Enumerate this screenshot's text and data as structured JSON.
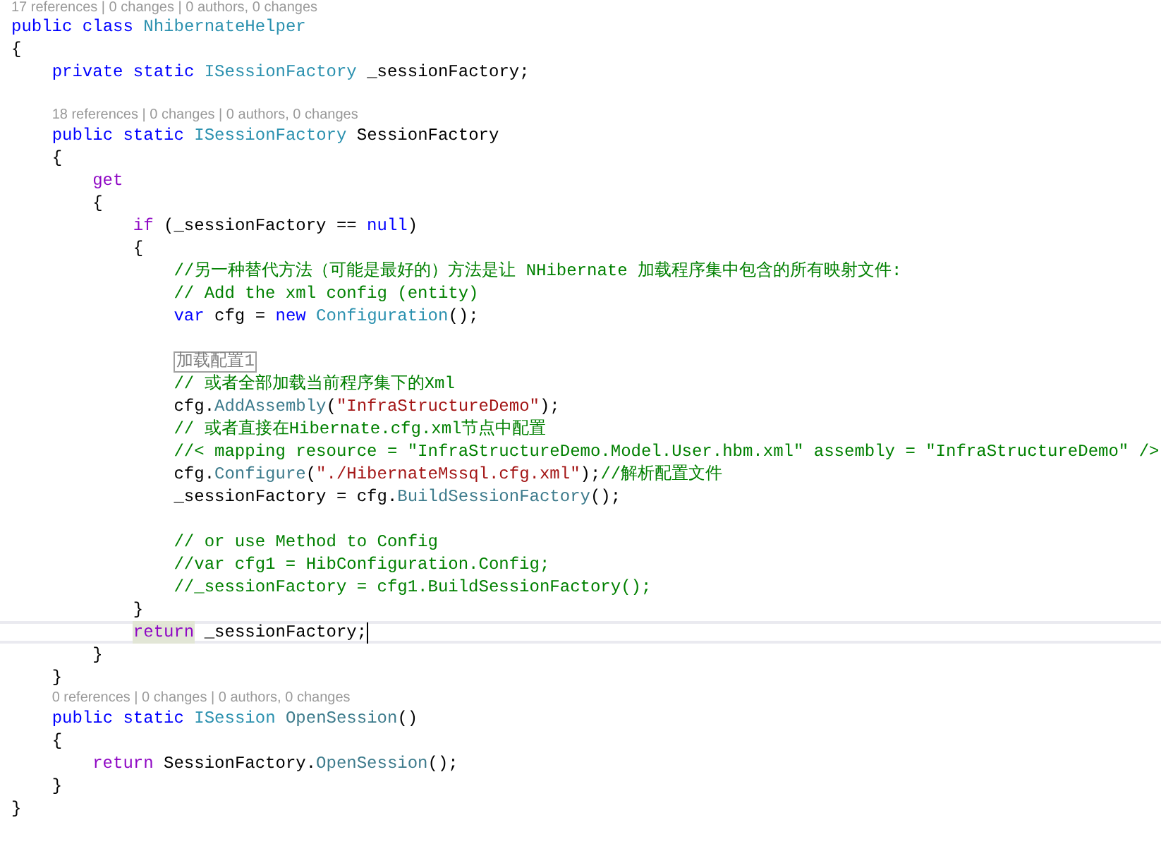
{
  "editor": {
    "lines": [
      {
        "kind": "lens",
        "text": "17 references | 0 changes | 0 authors, 0 changes"
      },
      {
        "kind": "code",
        "tokens": [
          {
            "kind": "kw",
            "text": "public"
          },
          {
            "kind": "kw",
            "text": " class"
          },
          {
            "kind": "type",
            "text": " NhibernateHelper"
          }
        ]
      },
      {
        "kind": "code",
        "tokens": [
          {
            "kind": "plain",
            "text": "{"
          }
        ]
      },
      {
        "kind": "code",
        "tokens": [
          {
            "kind": "kw",
            "text": "    private"
          },
          {
            "kind": "kw",
            "text": " static"
          },
          {
            "kind": "type",
            "text": " ISessionFactory"
          },
          {
            "kind": "plain",
            "text": " _sessionFactory;"
          }
        ]
      },
      {
        "kind": "blank"
      },
      {
        "kind": "lens",
        "text": "    18 references | 0 changes | 0 authors, 0 changes"
      },
      {
        "kind": "code",
        "tokens": [
          {
            "kind": "kw",
            "text": "    public"
          },
          {
            "kind": "kw",
            "text": " static"
          },
          {
            "kind": "type",
            "text": " ISessionFactory"
          },
          {
            "kind": "plain",
            "text": " SessionFactory"
          }
        ]
      },
      {
        "kind": "code",
        "tokens": [
          {
            "kind": "plain",
            "text": "    {"
          }
        ]
      },
      {
        "kind": "code",
        "tokens": [
          {
            "kind": "ctrl",
            "text": "        get"
          }
        ]
      },
      {
        "kind": "code",
        "tokens": [
          {
            "kind": "plain",
            "text": "        {"
          }
        ]
      },
      {
        "kind": "code",
        "tokens": [
          {
            "kind": "ctrl",
            "text": "            if"
          },
          {
            "kind": "plain",
            "text": " (_sessionFactory =="
          },
          {
            "kind": "kw",
            "text": " null"
          },
          {
            "kind": "plain",
            "text": ")"
          }
        ]
      },
      {
        "kind": "code",
        "tokens": [
          {
            "kind": "plain",
            "text": "            {"
          }
        ]
      },
      {
        "kind": "code",
        "tokens": [
          {
            "kind": "comment",
            "text": "                //另一种替代方法（可能是最好的）方法是让 NHibernate 加载程序集中包含的所有映射文件:"
          }
        ]
      },
      {
        "kind": "code",
        "tokens": [
          {
            "kind": "comment",
            "text": "                // Add the xml config (entity)"
          }
        ]
      },
      {
        "kind": "code",
        "tokens": [
          {
            "kind": "kw",
            "text": "                var"
          },
          {
            "kind": "plain",
            "text": " cfg ="
          },
          {
            "kind": "kw",
            "text": " new"
          },
          {
            "kind": "type",
            "text": " Configuration"
          },
          {
            "kind": "plain",
            "text": "();"
          }
        ]
      },
      {
        "kind": "blank"
      },
      {
        "kind": "region",
        "text": "                加载配置1"
      },
      {
        "kind": "code",
        "tokens": [
          {
            "kind": "comment",
            "text": "                // 或者全部加载当前程序集下的Xml"
          }
        ]
      },
      {
        "kind": "code",
        "tokens": [
          {
            "kind": "plain",
            "text": "                cfg."
          },
          {
            "kind": "method",
            "text": "AddAssembly"
          },
          {
            "kind": "plain",
            "text": "("
          },
          {
            "kind": "str",
            "text": "\"InfraStructureDemo\""
          },
          {
            "kind": "plain",
            "text": ");"
          }
        ]
      },
      {
        "kind": "code",
        "tokens": [
          {
            "kind": "comment",
            "text": "                // 或者直接在Hibernate.cfg.xml节点中配置"
          }
        ]
      },
      {
        "kind": "code",
        "tokens": [
          {
            "kind": "comment",
            "text": "                //< mapping resource = \"InfraStructureDemo.Model.User.hbm.xml\" assembly = \"InfraStructureDemo\" />"
          }
        ]
      },
      {
        "kind": "code",
        "tokens": [
          {
            "kind": "plain",
            "text": "                cfg."
          },
          {
            "kind": "method",
            "text": "Configure"
          },
          {
            "kind": "plain",
            "text": "("
          },
          {
            "kind": "str",
            "text": "\"./HibernateMssql.cfg.xml\""
          },
          {
            "kind": "plain",
            "text": ");"
          },
          {
            "kind": "comment",
            "text": "//解析配置文件"
          }
        ]
      },
      {
        "kind": "code",
        "tokens": [
          {
            "kind": "plain",
            "text": "                _sessionFactory = cfg."
          },
          {
            "kind": "method",
            "text": "BuildSessionFactory"
          },
          {
            "kind": "plain",
            "text": "();"
          }
        ]
      },
      {
        "kind": "blank"
      },
      {
        "kind": "code",
        "tokens": [
          {
            "kind": "comment",
            "text": "                // or use Method to Config"
          }
        ]
      },
      {
        "kind": "code",
        "tokens": [
          {
            "kind": "comment",
            "text": "                //var cfg1 = HibConfiguration.Config;"
          }
        ]
      },
      {
        "kind": "code",
        "tokens": [
          {
            "kind": "comment",
            "text": "                //_sessionFactory = cfg1.BuildSessionFactory();"
          }
        ]
      },
      {
        "kind": "code",
        "tokens": [
          {
            "kind": "plain",
            "text": "            }"
          }
        ]
      },
      {
        "kind": "code",
        "current": true,
        "tokens": [
          {
            "kind": "ctrl",
            "text": "            return",
            "highlighted": true
          },
          {
            "kind": "plain",
            "text": " _sessionFactory;"
          }
        ]
      },
      {
        "kind": "code",
        "tokens": [
          {
            "kind": "plain",
            "text": "        }"
          }
        ]
      },
      {
        "kind": "code",
        "tokens": [
          {
            "kind": "plain",
            "text": "    }"
          }
        ]
      },
      {
        "kind": "lens",
        "text": "    0 references | 0 changes | 0 authors, 0 changes"
      },
      {
        "kind": "code",
        "tokens": [
          {
            "kind": "kw",
            "text": "    public"
          },
          {
            "kind": "kw",
            "text": " static"
          },
          {
            "kind": "type",
            "text": " ISession"
          },
          {
            "kind": "method",
            "text": " OpenSession"
          },
          {
            "kind": "plain",
            "text": "()"
          }
        ]
      },
      {
        "kind": "code",
        "tokens": [
          {
            "kind": "plain",
            "text": "    {"
          }
        ]
      },
      {
        "kind": "code",
        "tokens": [
          {
            "kind": "ctrl",
            "text": "        return"
          },
          {
            "kind": "plain",
            "text": " SessionFactory."
          },
          {
            "kind": "method",
            "text": "OpenSession"
          },
          {
            "kind": "plain",
            "text": "();"
          }
        ]
      },
      {
        "kind": "code",
        "tokens": [
          {
            "kind": "plain",
            "text": "    }"
          }
        ]
      },
      {
        "kind": "code",
        "tokens": [
          {
            "kind": "plain",
            "text": "}"
          }
        ]
      }
    ]
  }
}
